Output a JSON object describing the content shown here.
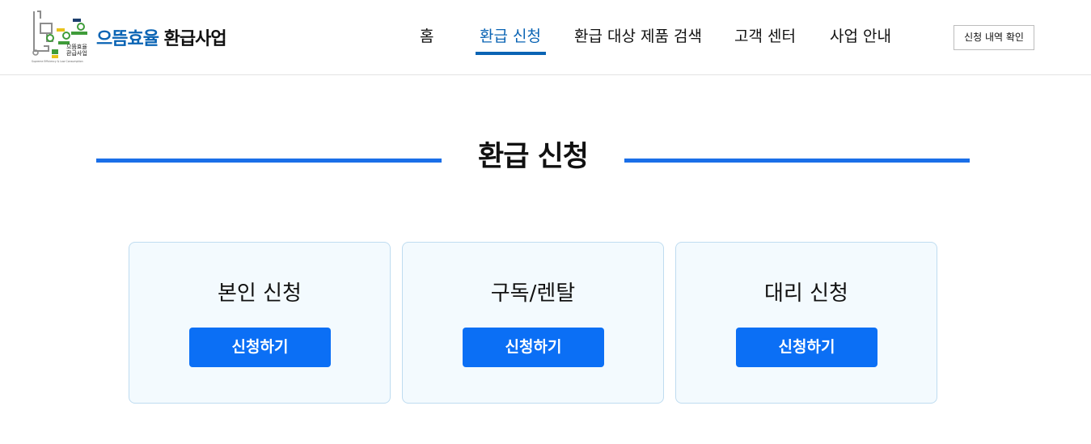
{
  "logo": {
    "name_accent": "으뜸효율",
    "name_main": "환급사업",
    "mark_small_text_line1": "으뜸효율",
    "mark_small_text_line2": "환급사업",
    "mark_tagline": "Supreme Efficiency & Low Consumption",
    "colors": {
      "gray": "#8d8d8d",
      "green": "#3f9c3a",
      "yellow": "#e8c21a",
      "navy": "#1d3f6e"
    }
  },
  "nav": {
    "items": [
      {
        "label": "홈",
        "active": false
      },
      {
        "label": "환급 신청",
        "active": true
      },
      {
        "label": "환급 대상 제품 검색",
        "active": false
      },
      {
        "label": "고객 센터",
        "active": false
      },
      {
        "label": "사업 안내",
        "active": false
      }
    ],
    "history_button": "신청 내역 확인"
  },
  "section": {
    "title": "환급 신청"
  },
  "cards": [
    {
      "title": "본인 신청",
      "button": "신청하기"
    },
    {
      "title": "구독/렌탈",
      "button": "신청하기"
    },
    {
      "title": "대리 신청",
      "button": "신청하기"
    }
  ],
  "colors": {
    "accent_blue": "#0a64b4",
    "button_blue": "#0b6ff5",
    "rule_blue": "#1a6fe8",
    "card_bg": "#f3fafe",
    "card_border": "#bfdcf0"
  }
}
